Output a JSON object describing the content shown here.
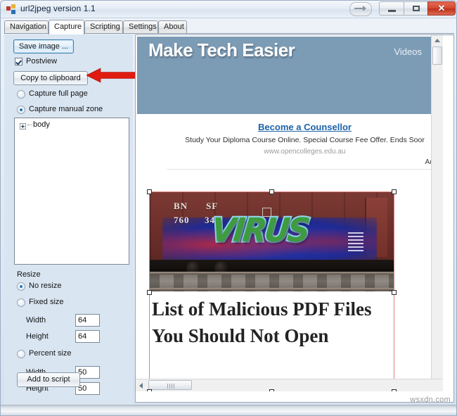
{
  "window": {
    "title": "url2jpeg version 1.1",
    "app_icon": "app-squares-icon",
    "controls": {
      "help": "help-arrow-icon",
      "minimize": "—",
      "maximize": "□",
      "close": "✕"
    }
  },
  "tabs": [
    {
      "label": "Navigation",
      "active": false
    },
    {
      "label": "Capture",
      "active": true
    },
    {
      "label": "Scripting",
      "active": false
    },
    {
      "label": "Settings",
      "active": false
    },
    {
      "label": "About",
      "active": false
    }
  ],
  "capture_panel": {
    "save_image_label": "Save image ...",
    "postview_label": "Postview",
    "postview_checked": true,
    "copy_to_clipboard_label": "Copy to clipboard",
    "capture_mode": [
      {
        "label": "Capture full page",
        "selected": false
      },
      {
        "label": "Capture manual zone",
        "selected": true
      }
    ],
    "tree": {
      "root_label": "body",
      "expander": "plus-icon"
    },
    "resize": {
      "section_label": "Resize",
      "options": [
        {
          "label": "No resize",
          "selected": true
        },
        {
          "label": "Fixed size",
          "selected": false
        },
        {
          "label": "Percent size",
          "selected": false
        }
      ],
      "fixed": {
        "width_label": "Width",
        "width_value": "64",
        "height_label": "Height",
        "height_value": "64"
      },
      "percent": {
        "width_label": "Width",
        "width_value": "50",
        "height_label": "Height",
        "height_value": "50"
      }
    },
    "add_to_script_label": "Add to script",
    "annotation_arrow": "red-left-arrow-icon"
  },
  "preview": {
    "site": {
      "title": "Make Tech Easier",
      "nav_link": "Videos",
      "header_color": "#7c9bb5"
    },
    "ad": {
      "title": "Become a Counsellor",
      "description": "Study Your Diploma Course Online. Special Course Fee Offer. Ends Soor",
      "url": "www.opencolleges.edu.au",
      "choices_label": "AdC"
    },
    "image": {
      "alt": "graffiti boxcar photo",
      "reporting_mark": "BN",
      "reporting_mark_2": "SF",
      "car_number": "760",
      "car_number_2": "345",
      "graffiti_text": "VIRUS"
    },
    "headline": "List of Malicious PDF Files You Should Not Open",
    "selection_border_color": "#e08080",
    "scrollbars": {
      "vertical_up": "arrow-up-icon",
      "horizontal_left": "arrow-left-icon"
    }
  },
  "watermark": "wsxdn.com"
}
